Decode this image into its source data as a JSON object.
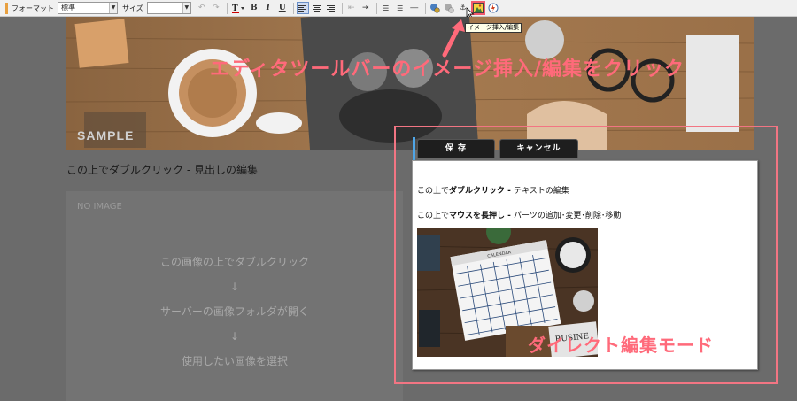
{
  "toolbar": {
    "format_label": "フォーマット",
    "format_value": "標準",
    "size_label": "サイズ",
    "size_value": "",
    "tooltip": "イメージ挿入/編集"
  },
  "hero": {
    "sample_text": "SAMPLE"
  },
  "heading": {
    "text": "この上でダブルクリック - 見出しの編集"
  },
  "noimage": {
    "tag": "NO IMAGE",
    "steps": [
      "この画像の上でダブルクリック",
      "↓",
      "サーバーの画像フォルダが開く",
      "↓",
      "使用したい画像を選択"
    ]
  },
  "annotation": {
    "callout": "エディタツールバーのイメージ挿入/編集をクリック",
    "mode_label": "ダイレクト編集モード",
    "accent_color": "#ff6a7a"
  },
  "editor": {
    "save_label": "保 存",
    "cancel_label": "キャンセル",
    "line1_pre": "この上で",
    "line1_bold": "ダブルクリック - ",
    "line1_post": "テキストの編集",
    "line2_pre": "この上で",
    "line2_bold": "マウスを長押し - ",
    "line2_post": "パーツの追加･変更･削除･移動",
    "image_text": "BUSINE"
  },
  "calendar": {
    "title": "CALENDAR"
  }
}
